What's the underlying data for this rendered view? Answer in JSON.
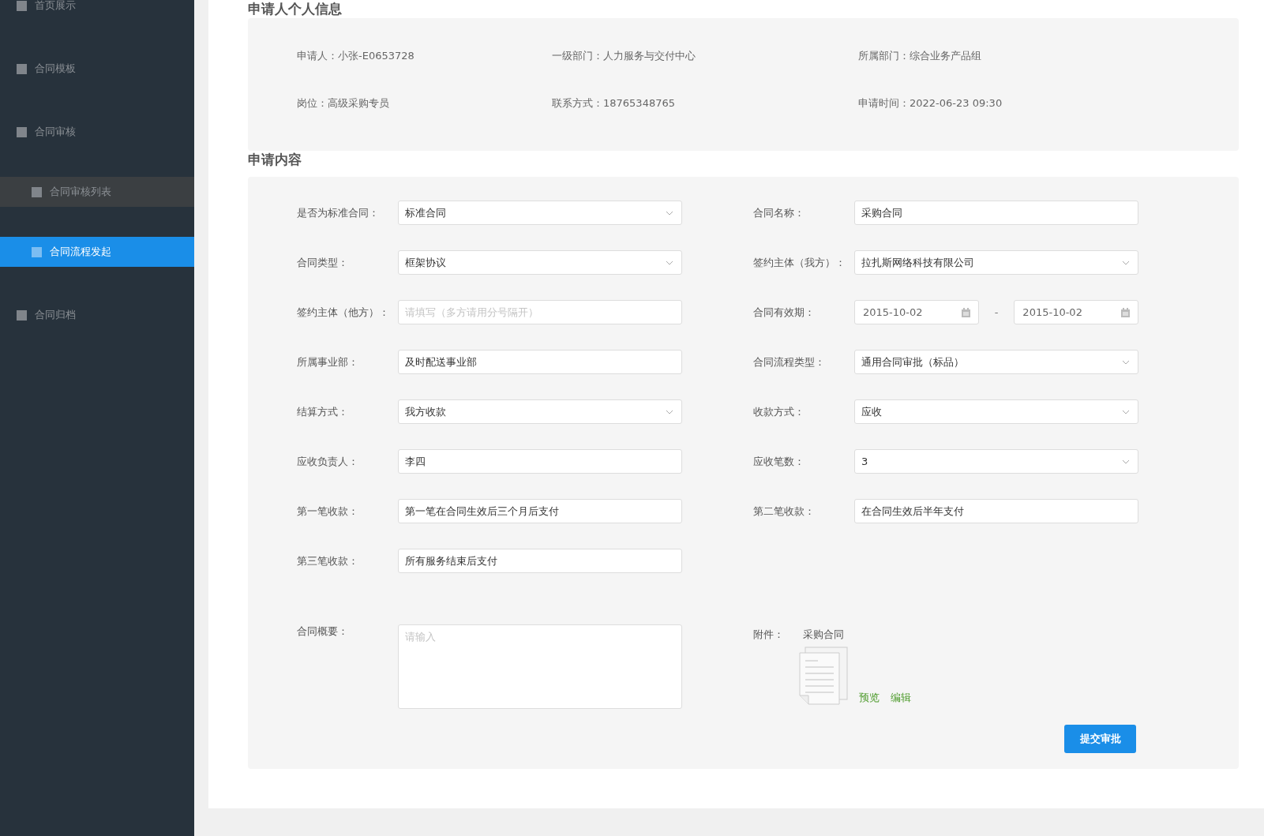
{
  "sidebar": {
    "items": [
      {
        "label": "首页展示",
        "selected": false,
        "highlighted": false
      },
      {
        "label": "合同模板",
        "selected": false,
        "highlighted": false
      },
      {
        "label": "合同审核",
        "selected": false,
        "highlighted": false,
        "children": [
          {
            "label": "合同审核列表",
            "selected": false,
            "highlighted": true
          },
          {
            "label": "合同流程发起",
            "selected": true,
            "highlighted": false
          }
        ]
      },
      {
        "label": "合同归档",
        "selected": false,
        "highlighted": false
      }
    ]
  },
  "applicant": {
    "title": "申请人个人信息",
    "fields": [
      {
        "label": "申请人：",
        "value": "小张-E0653728"
      },
      {
        "label": "一级部门：",
        "value": "人力服务与交付中心"
      },
      {
        "label": "所属部门：",
        "value": "综合业务产品组"
      },
      {
        "label": "岗位：",
        "value": "高级采购专员"
      },
      {
        "label": "联系方式：",
        "value": "18765348765"
      },
      {
        "label": "申请时间：",
        "value": "2022-06-23 09:30"
      }
    ]
  },
  "content": {
    "title": "申请内容",
    "fields": [
      {
        "label": "是否为标准合同：",
        "kind": "select",
        "value": "标准合同"
      },
      {
        "label": "合同名称：",
        "kind": "input",
        "value": "采购合同"
      },
      {
        "label": "合同类型：",
        "kind": "select",
        "value": "框架协议"
      },
      {
        "label": "签约主体（我方）：",
        "kind": "select",
        "value": "拉扎斯网络科技有限公司"
      },
      {
        "label": "签约主体（他方）：",
        "kind": "input",
        "placeholder": "请填写（多方请用分号隔开）"
      },
      {
        "label": "合同有效期：",
        "kind": "daterange",
        "start": "2015-10-02",
        "separator": "-",
        "end": "2015-10-02"
      },
      {
        "label": "所属事业部：",
        "kind": "input",
        "value": "及时配送事业部"
      },
      {
        "label": "合同流程类型：",
        "kind": "select",
        "value": "通用合同审批（标品）"
      },
      {
        "label": "结算方式：",
        "kind": "select",
        "value": "我方收款"
      },
      {
        "label": "收款方式：",
        "kind": "select",
        "value": "应收"
      },
      {
        "label": "应收负责人：",
        "kind": "input",
        "value": "李四"
      },
      {
        "label": "应收笔数：",
        "kind": "select",
        "value": "3"
      },
      {
        "label": "第一笔收款：",
        "kind": "input",
        "value": "第一笔在合同生效后三个月后支付"
      },
      {
        "label": "第二笔收款：",
        "kind": "input",
        "value": "在合同生效后半年支付"
      },
      {
        "label": "第三笔收款：",
        "kind": "input",
        "value": "所有服务结束后支付"
      }
    ],
    "summary": {
      "label": "合同概要：",
      "placeholder": "请输入"
    },
    "attachment": {
      "label": "附件：",
      "name": "采购合同",
      "actions": [
        "预览",
        "编辑"
      ]
    },
    "submit": "提交审批"
  }
}
